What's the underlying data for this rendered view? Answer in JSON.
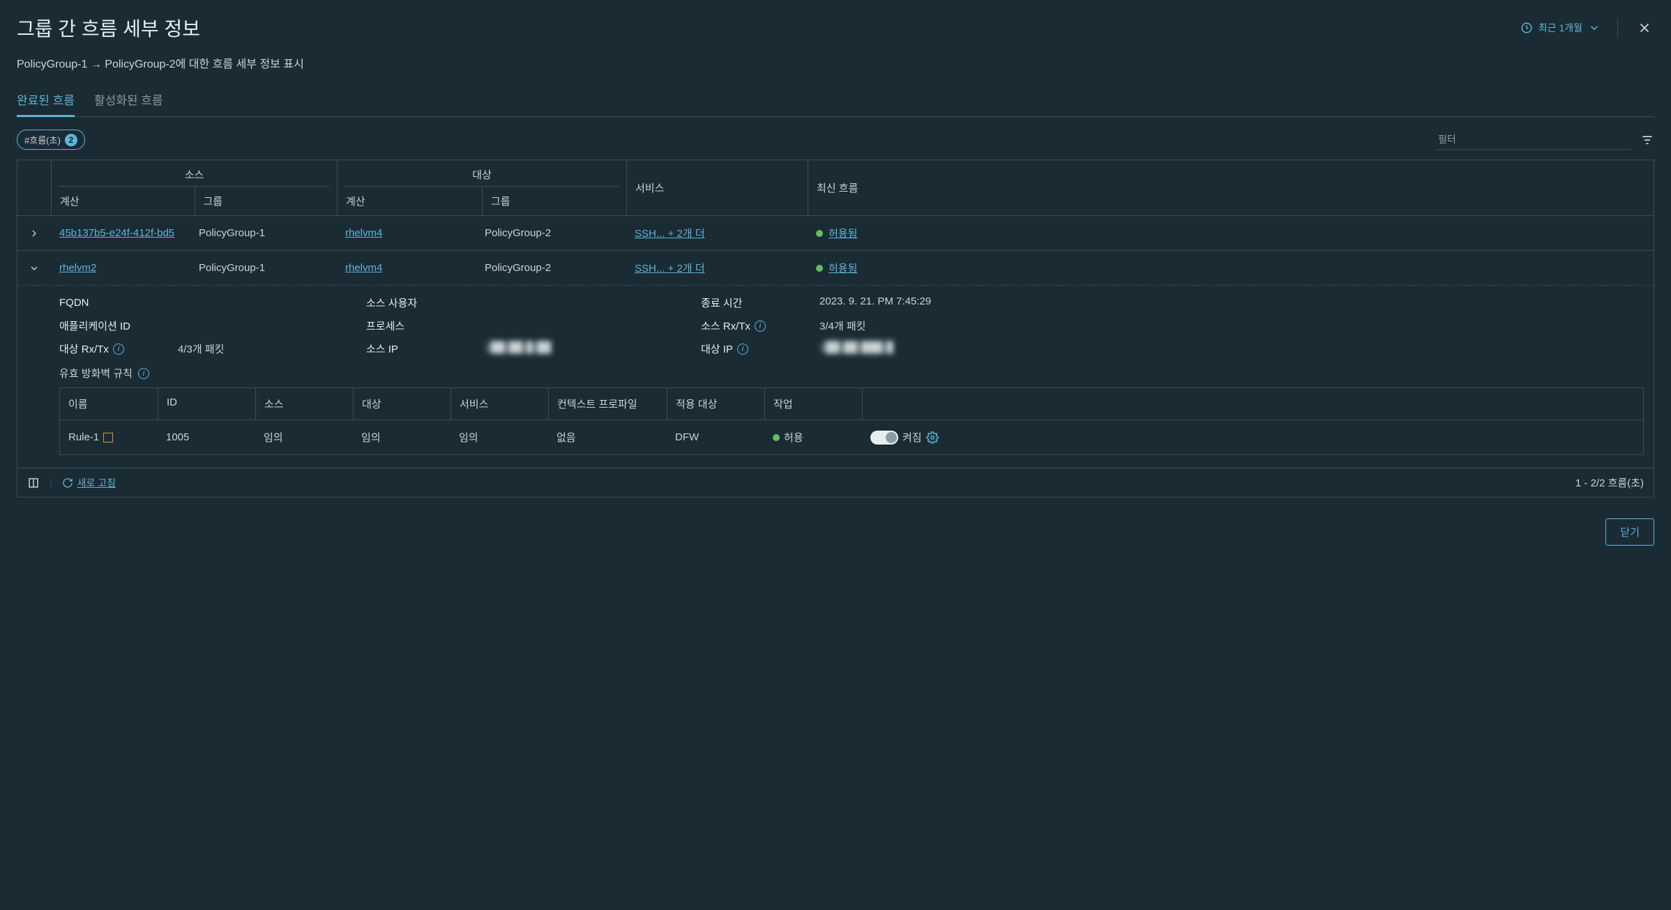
{
  "header": {
    "title": "그룹 간 흐름 세부 정보",
    "time_range": "최근 1개월"
  },
  "subtitle": "PolicyGroup-1 → PolicyGroup-2에 대한 흐름 세부 정보 표시",
  "tabs": {
    "completed": "완료된 흐름",
    "active": "활성화된 흐름"
  },
  "chip": {
    "label": "#흐름(초)",
    "count": "2"
  },
  "filter": {
    "placeholder": "필터"
  },
  "columns": {
    "source": "소스",
    "destination": "대상",
    "compute": "계산",
    "group": "그룹",
    "service": "서비스",
    "latest_flow": "최신 흐름"
  },
  "rows": [
    {
      "expanded": false,
      "src_compute": "45b137b5-e24f-412f-bd5",
      "src_group": "PolicyGroup-1",
      "dst_compute": "rhelvm4",
      "dst_group": "PolicyGroup-2",
      "service": "SSH... + 2개 더",
      "status": "허용됨"
    },
    {
      "expanded": true,
      "src_compute": "rhelvm2",
      "src_group": "PolicyGroup-1",
      "dst_compute": "rhelvm4",
      "dst_group": "PolicyGroup-2",
      "service": "SSH... + 2개 더",
      "status": "허용됨"
    }
  ],
  "details": {
    "labels": {
      "fqdn": "FQDN",
      "src_user": "소스 사용자",
      "end_time": "종료 시간",
      "app_id": "애플리케이션 ID",
      "process": "프로세스",
      "src_rxtx": "소스 Rx/Tx",
      "dst_rxtx": "대상 Rx/Tx",
      "src_ip": "소스 IP",
      "dst_ip": "대상 IP",
      "firewall_rule": "유효 방화벽 규칙"
    },
    "values": {
      "end_time": "2023. 9. 21. PM 7:45:29",
      "src_rxtx": "3/4개 패킷",
      "dst_rxtx": "4/3개 패킷",
      "src_ip": "1██.██.█.██",
      "dst_ip": "1██.██.███.█"
    }
  },
  "rule_table": {
    "headers": {
      "name": "이름",
      "id": "ID",
      "source": "소스",
      "destination": "대상",
      "service": "서비스",
      "context_profile": "컨텍스트 프로파일",
      "applied_to": "적용 대상",
      "action": "작업"
    },
    "row": {
      "name": "Rule-1",
      "id": "1005",
      "source": "임의",
      "destination": "임의",
      "service": "임의",
      "context_profile": "없음",
      "applied_to": "DFW",
      "action": "허용",
      "toggle_label": "켜짐"
    }
  },
  "footer": {
    "refresh": "새로 고침",
    "pagination": "1 - 2/2 흐름(초)"
  },
  "dialog": {
    "close": "닫기"
  }
}
